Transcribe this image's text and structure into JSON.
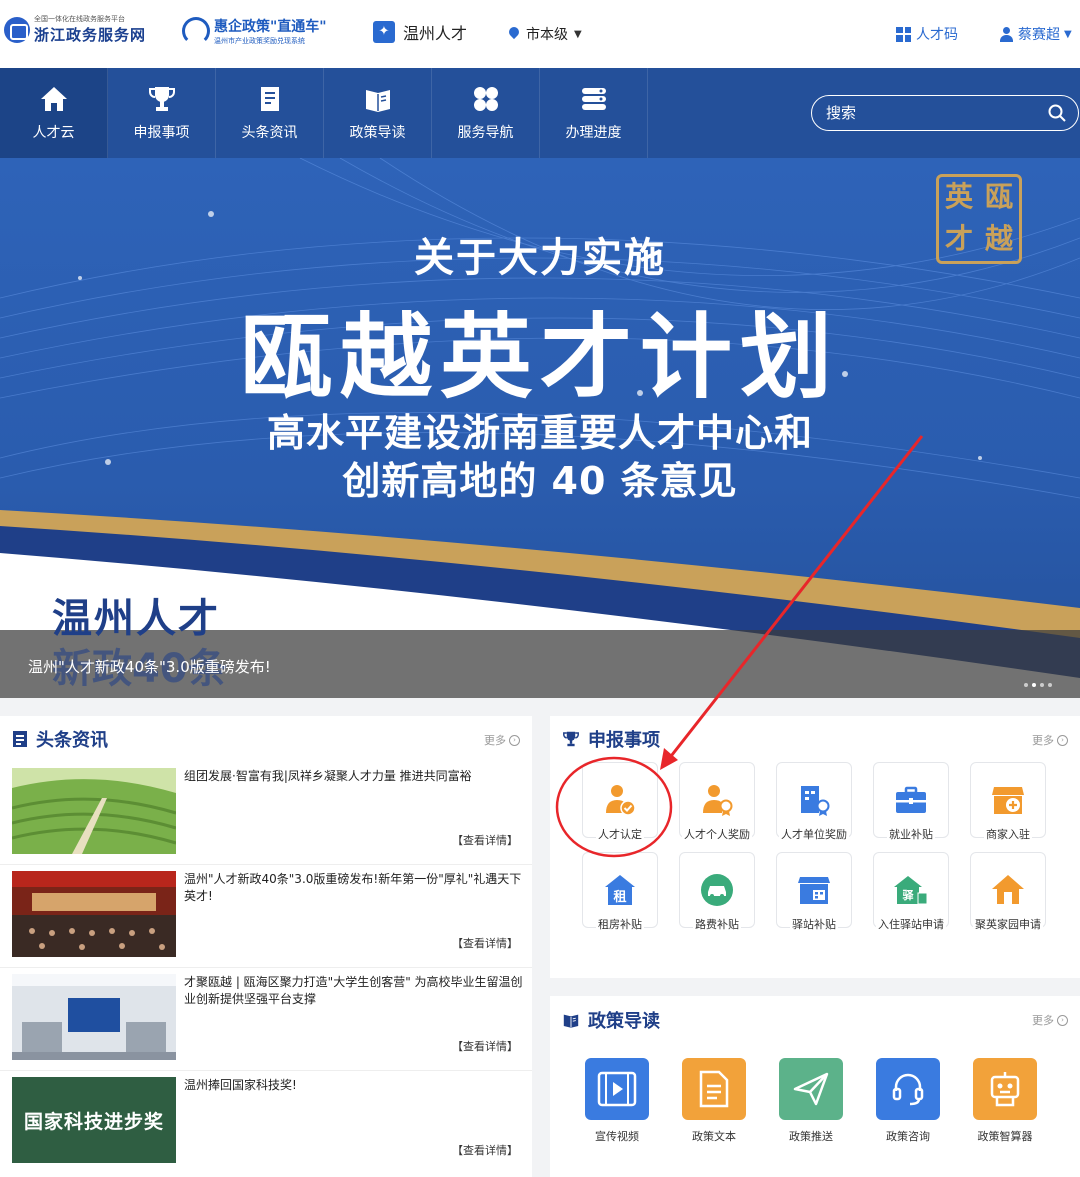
{
  "header": {
    "zj_small": "全国一体化在线政务服务平台",
    "zj_title": "浙江政务服务网",
    "hqzc_title": "惠企政策\"直通车\"",
    "hqzc_sub": "温州市产业政策奖励兑现系统",
    "wzrc_title": "温州人才",
    "city": "市本级",
    "rencai_code": "人才码",
    "username": "蔡赛超"
  },
  "nav": {
    "items": [
      {
        "label": "人才云",
        "icon": "home-icon"
      },
      {
        "label": "申报事项",
        "icon": "trophy-icon"
      },
      {
        "label": "头条资讯",
        "icon": "news-icon"
      },
      {
        "label": "政策导读",
        "icon": "book-icon"
      },
      {
        "label": "服务导航",
        "icon": "grid-icon"
      },
      {
        "label": "办理进度",
        "icon": "progress-icon"
      }
    ],
    "search_placeholder": "搜索"
  },
  "banner": {
    "line1": "关于大力实施",
    "line2": "瓯越英才计划",
    "line3": "高水平建设浙南重要人才中心和",
    "line4": "创新高地的 40 条意见",
    "seal_chars": [
      "英",
      "瓯",
      "才",
      "越"
    ],
    "corner_title": "温州人才",
    "corner_sub": "新政40条",
    "caption": "温州\"人才新政40条\"3.0版重磅发布!",
    "dot_count": 4,
    "active_dot": 2
  },
  "news": {
    "title": "头条资讯",
    "more": "更多",
    "items": [
      {
        "title": "组团发展·智富有我|凤祥乡凝聚人才力量 推进共同富裕",
        "link": "【查看详情】"
      },
      {
        "title": "温州\"人才新政40条\"3.0版重磅发布!新年第一份\"厚礼\"礼遇天下英才!",
        "link": "【查看详情】"
      },
      {
        "title": "才聚瓯越 | 瓯海区聚力打造\"大学生创客营\" 为高校毕业生留温创业创新提供坚强平台支撑",
        "link": "【查看详情】"
      },
      {
        "title": "温州捧回国家科技奖!",
        "link": "【查看详情】",
        "image_text": "国家科技进步奖"
      }
    ]
  },
  "declare": {
    "title": "申报事项",
    "more": "更多",
    "items": [
      {
        "label": "人才认定",
        "icon": "talent-certify-icon",
        "color": "#f29a2e"
      },
      {
        "label": "人才个人奖励",
        "icon": "personal-award-icon",
        "color": "#f29a2e"
      },
      {
        "label": "人才单位奖励",
        "icon": "unit-award-icon",
        "color": "#3a7be0"
      },
      {
        "label": "就业补贴",
        "icon": "briefcase-icon",
        "color": "#3a7be0"
      },
      {
        "label": "商家入驻",
        "icon": "store-icon",
        "color": "#f29a2e"
      },
      {
        "label": "租房补贴",
        "icon": "rent-house-icon",
        "color": "#3a7be0",
        "glyph": "租"
      },
      {
        "label": "路费补贴",
        "icon": "car-icon",
        "color": "#3aab7b"
      },
      {
        "label": "驿站补贴",
        "icon": "station-icon",
        "color": "#3a7be0"
      },
      {
        "label": "入住驿站申请",
        "icon": "station-house-icon",
        "color": "#3aab7b",
        "glyph": "驿"
      },
      {
        "label": "聚英家园申请",
        "icon": "home-apply-icon",
        "color": "#f29a2e"
      }
    ]
  },
  "policy": {
    "title": "政策导读",
    "more": "更多",
    "items": [
      {
        "label": "宣传视频",
        "icon": "video-icon",
        "color": "#3a7be0"
      },
      {
        "label": "政策文本",
        "icon": "document-icon",
        "color": "#f2a23a"
      },
      {
        "label": "政策推送",
        "icon": "send-icon",
        "color": "#5cb28a"
      },
      {
        "label": "政策咨询",
        "icon": "headset-icon",
        "color": "#3a7be0"
      },
      {
        "label": "政策智算器",
        "icon": "robot-icon",
        "color": "#f2a23a"
      }
    ]
  },
  "colors": {
    "nav_bg": "#24509a",
    "banner_bg": "#2e63b8",
    "accent_blue": "#1f3f88",
    "annotation_red": "#e8262a",
    "gold": "#c9a15a"
  }
}
